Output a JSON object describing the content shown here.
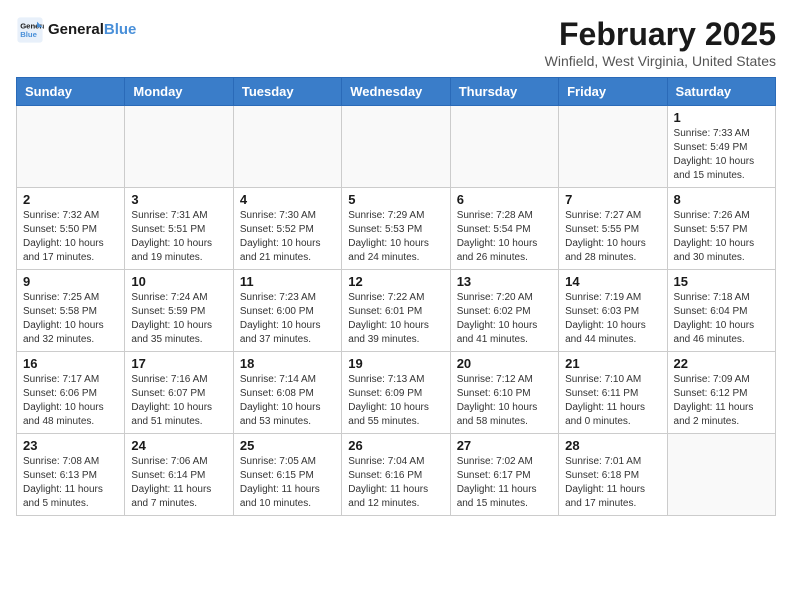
{
  "header": {
    "logo_line1": "General",
    "logo_line2": "Blue",
    "month_year": "February 2025",
    "location": "Winfield, West Virginia, United States"
  },
  "days_of_week": [
    "Sunday",
    "Monday",
    "Tuesday",
    "Wednesday",
    "Thursday",
    "Friday",
    "Saturday"
  ],
  "weeks": [
    [
      {
        "day": "",
        "info": ""
      },
      {
        "day": "",
        "info": ""
      },
      {
        "day": "",
        "info": ""
      },
      {
        "day": "",
        "info": ""
      },
      {
        "day": "",
        "info": ""
      },
      {
        "day": "",
        "info": ""
      },
      {
        "day": "1",
        "info": "Sunrise: 7:33 AM\nSunset: 5:49 PM\nDaylight: 10 hours and 15 minutes."
      }
    ],
    [
      {
        "day": "2",
        "info": "Sunrise: 7:32 AM\nSunset: 5:50 PM\nDaylight: 10 hours and 17 minutes."
      },
      {
        "day": "3",
        "info": "Sunrise: 7:31 AM\nSunset: 5:51 PM\nDaylight: 10 hours and 19 minutes."
      },
      {
        "day": "4",
        "info": "Sunrise: 7:30 AM\nSunset: 5:52 PM\nDaylight: 10 hours and 21 minutes."
      },
      {
        "day": "5",
        "info": "Sunrise: 7:29 AM\nSunset: 5:53 PM\nDaylight: 10 hours and 24 minutes."
      },
      {
        "day": "6",
        "info": "Sunrise: 7:28 AM\nSunset: 5:54 PM\nDaylight: 10 hours and 26 minutes."
      },
      {
        "day": "7",
        "info": "Sunrise: 7:27 AM\nSunset: 5:55 PM\nDaylight: 10 hours and 28 minutes."
      },
      {
        "day": "8",
        "info": "Sunrise: 7:26 AM\nSunset: 5:57 PM\nDaylight: 10 hours and 30 minutes."
      }
    ],
    [
      {
        "day": "9",
        "info": "Sunrise: 7:25 AM\nSunset: 5:58 PM\nDaylight: 10 hours and 32 minutes."
      },
      {
        "day": "10",
        "info": "Sunrise: 7:24 AM\nSunset: 5:59 PM\nDaylight: 10 hours and 35 minutes."
      },
      {
        "day": "11",
        "info": "Sunrise: 7:23 AM\nSunset: 6:00 PM\nDaylight: 10 hours and 37 minutes."
      },
      {
        "day": "12",
        "info": "Sunrise: 7:22 AM\nSunset: 6:01 PM\nDaylight: 10 hours and 39 minutes."
      },
      {
        "day": "13",
        "info": "Sunrise: 7:20 AM\nSunset: 6:02 PM\nDaylight: 10 hours and 41 minutes."
      },
      {
        "day": "14",
        "info": "Sunrise: 7:19 AM\nSunset: 6:03 PM\nDaylight: 10 hours and 44 minutes."
      },
      {
        "day": "15",
        "info": "Sunrise: 7:18 AM\nSunset: 6:04 PM\nDaylight: 10 hours and 46 minutes."
      }
    ],
    [
      {
        "day": "16",
        "info": "Sunrise: 7:17 AM\nSunset: 6:06 PM\nDaylight: 10 hours and 48 minutes."
      },
      {
        "day": "17",
        "info": "Sunrise: 7:16 AM\nSunset: 6:07 PM\nDaylight: 10 hours and 51 minutes."
      },
      {
        "day": "18",
        "info": "Sunrise: 7:14 AM\nSunset: 6:08 PM\nDaylight: 10 hours and 53 minutes."
      },
      {
        "day": "19",
        "info": "Sunrise: 7:13 AM\nSunset: 6:09 PM\nDaylight: 10 hours and 55 minutes."
      },
      {
        "day": "20",
        "info": "Sunrise: 7:12 AM\nSunset: 6:10 PM\nDaylight: 10 hours and 58 minutes."
      },
      {
        "day": "21",
        "info": "Sunrise: 7:10 AM\nSunset: 6:11 PM\nDaylight: 11 hours and 0 minutes."
      },
      {
        "day": "22",
        "info": "Sunrise: 7:09 AM\nSunset: 6:12 PM\nDaylight: 11 hours and 2 minutes."
      }
    ],
    [
      {
        "day": "23",
        "info": "Sunrise: 7:08 AM\nSunset: 6:13 PM\nDaylight: 11 hours and 5 minutes."
      },
      {
        "day": "24",
        "info": "Sunrise: 7:06 AM\nSunset: 6:14 PM\nDaylight: 11 hours and 7 minutes."
      },
      {
        "day": "25",
        "info": "Sunrise: 7:05 AM\nSunset: 6:15 PM\nDaylight: 11 hours and 10 minutes."
      },
      {
        "day": "26",
        "info": "Sunrise: 7:04 AM\nSunset: 6:16 PM\nDaylight: 11 hours and 12 minutes."
      },
      {
        "day": "27",
        "info": "Sunrise: 7:02 AM\nSunset: 6:17 PM\nDaylight: 11 hours and 15 minutes."
      },
      {
        "day": "28",
        "info": "Sunrise: 7:01 AM\nSunset: 6:18 PM\nDaylight: 11 hours and 17 minutes."
      },
      {
        "day": "",
        "info": ""
      }
    ]
  ]
}
